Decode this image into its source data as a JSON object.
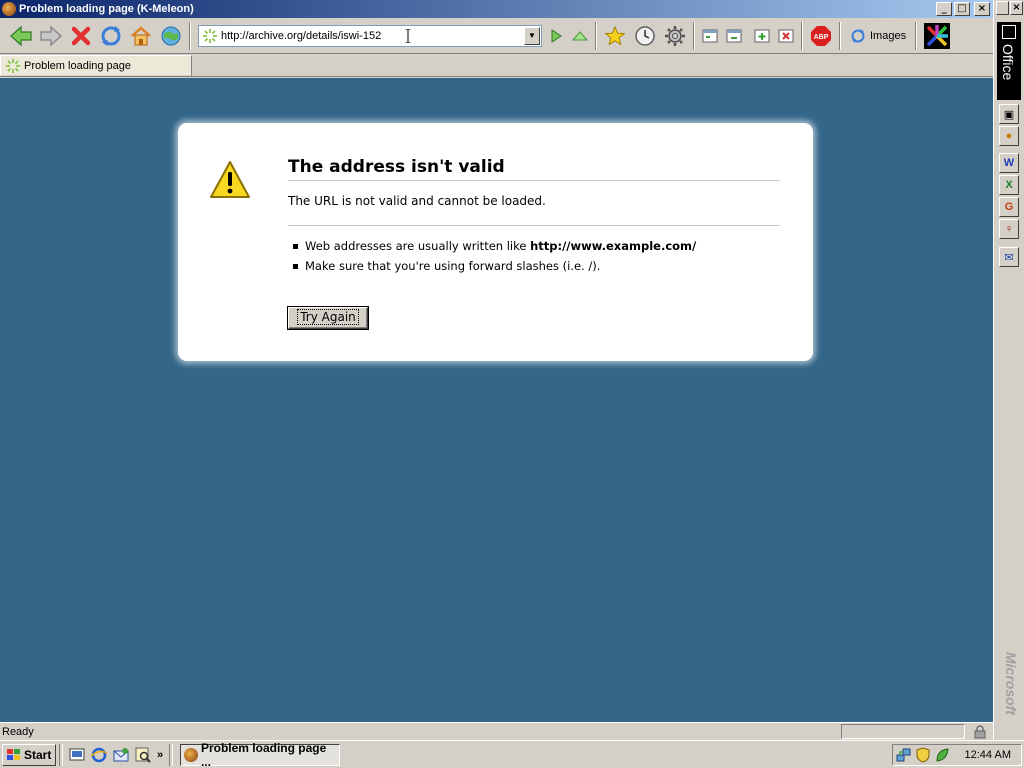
{
  "window": {
    "title": "Problem loading page (K-Meleon)",
    "buttons": {
      "minimize": "_",
      "maximize": "□",
      "close": "×"
    }
  },
  "toolbar": {
    "url": "http://archive.org/details/iswi-152",
    "dropdown": "▼",
    "images_label": "Images",
    "icons": [
      "back-icon",
      "forward-icon",
      "stop-icon",
      "reload-icon",
      "home-icon",
      "globe-icon",
      "go-icon",
      "up-icon",
      "bookmark-star-icon",
      "history-icon",
      "settings-gear-icon",
      "window-icon",
      "window-icon",
      "new-tab-icon",
      "close-tab-icon",
      "adblock-icon",
      "images-toggle-icon",
      "mosaic-icon"
    ],
    "adblock_text": "ABP"
  },
  "tab": {
    "label": "Problem loading page"
  },
  "error": {
    "title": "The address isn't valid",
    "description": "The URL is not valid and cannot be loaded.",
    "bullets": [
      {
        "text": "Web addresses are usually written like ",
        "bold": "http://www.example.com/"
      },
      {
        "text": "Make sure that you're using forward slashes (i.e. /).",
        "bold": ""
      }
    ],
    "button": "Try Again"
  },
  "status": {
    "text": "Ready"
  },
  "office_bar": {
    "label": "Office",
    "brand": "Microsoft",
    "apps": [
      {
        "name": "office-window-icon",
        "glyph": "▣",
        "color": "#000000"
      },
      {
        "name": "office-camera-icon",
        "glyph": "●",
        "color": "#c08000"
      },
      {
        "name": "word-icon",
        "glyph": "W",
        "color": "#1f3fb0"
      },
      {
        "name": "excel-icon",
        "glyph": "X",
        "color": "#1f7f2f"
      },
      {
        "name": "powerpoint-icon",
        "glyph": "G",
        "color": "#c04010"
      },
      {
        "name": "access-icon",
        "glyph": "♀",
        "color": "#a01010"
      },
      {
        "name": "outlook-icon",
        "glyph": "✉",
        "color": "#1f3fb0"
      }
    ]
  },
  "taskbar": {
    "start_label": "Start",
    "more": "»",
    "task_label": "Problem loading page ...",
    "clock": "12:44 AM"
  },
  "colors": {
    "content_bg": "#336688",
    "titlebar_start": "#0a246a",
    "titlebar_end": "#a6caf0",
    "chrome": "#d4d0c8"
  }
}
